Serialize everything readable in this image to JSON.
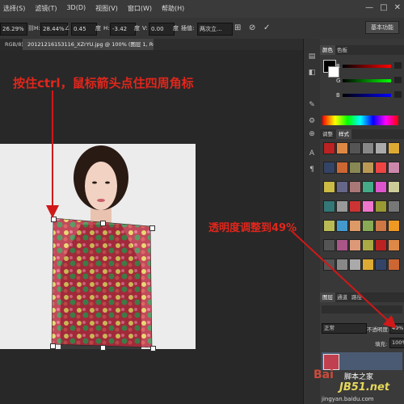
{
  "menubar": {
    "items": [
      "选择(S)",
      "滤镜(T)",
      "3D(D)",
      "视图(V)",
      "窗口(W)",
      "帮助(H)"
    ],
    "window_controls": [
      "—",
      "□",
      "✕"
    ]
  },
  "options_bar": {
    "scale_w": "26.29%",
    "h_label": "H:",
    "scale_h": "28.44%",
    "angle": "0.45",
    "angle_unit": "度",
    "h_skew_label": "H:",
    "h_skew": "-3.42",
    "h_skew_unit": "度",
    "v_label": "V:",
    "v_skew": "0.00",
    "v_skew_unit": "度",
    "interp_label": "插值:",
    "interp_value": "两次立...",
    "workspace": "基本功能"
  },
  "tabs": {
    "tab_a": "RGB/8)",
    "tab_b": "20121216153116_XZrYU.jpg @ 100% (图层 1, RGB/8) *",
    "tab_b_close": "×"
  },
  "panels": {
    "color_tabs": [
      "颜色",
      "色板"
    ],
    "slider_labels": [
      "R",
      "G",
      "B"
    ],
    "slider_values": [
      "",
      "",
      ""
    ],
    "styles_tabs": [
      "调整",
      "样式"
    ],
    "layers_tabs": [
      "图层",
      "通道",
      "路径"
    ],
    "blend_mode": "正常",
    "opacity_label": "不透明度:",
    "opacity_value": "49%",
    "fill_label": "填充:",
    "fill_value": "100%"
  },
  "annotations": {
    "top": "按住ctrl，鼠标箭头点住四周角标",
    "right": "透明度调整到49%"
  },
  "watermarks": {
    "baidu": "Bai",
    "site_cn": "脚本之家",
    "site": "JB51.net",
    "jingyan": "jingyan.baidu.com"
  },
  "colors": {
    "annotation": "#e0261c",
    "ui_bg": "#282828"
  }
}
